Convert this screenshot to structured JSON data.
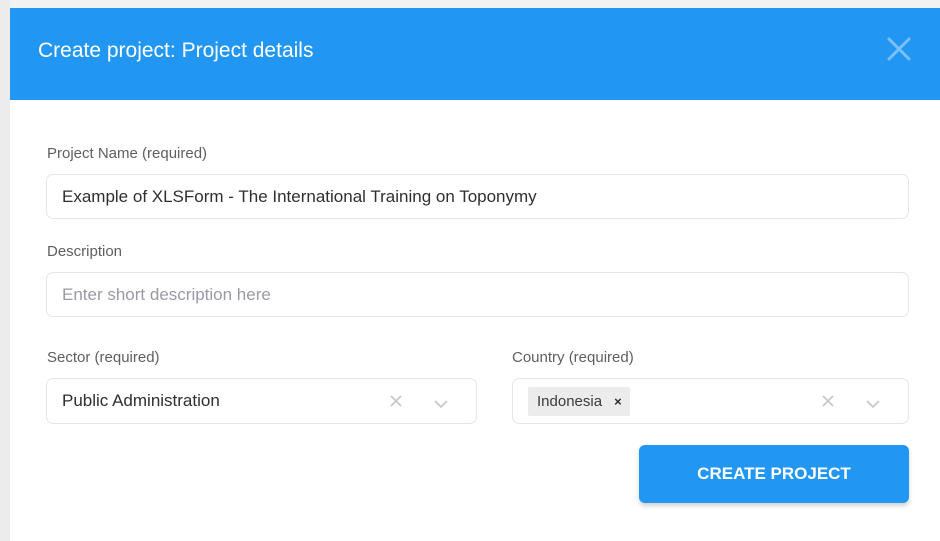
{
  "modal": {
    "title": "Create project: Project details",
    "close_icon": "close-icon"
  },
  "form": {
    "project_name": {
      "label": "Project Name (required)",
      "value": "Example of XLSForm - The International Training on Toponymy"
    },
    "description": {
      "label": "Description",
      "value": "",
      "placeholder": "Enter short description here"
    },
    "sector": {
      "label": "Sector (required)",
      "value": "Public Administration",
      "clear_icon": "clear-icon",
      "dropdown_icon": "chevron-down-icon"
    },
    "country": {
      "label": "Country (required)",
      "selected": [
        "Indonesia"
      ],
      "chip_remove": "×",
      "clear_icon": "clear-icon",
      "dropdown_icon": "chevron-down-icon"
    },
    "submit_label": "CREATE PROJECT"
  },
  "colors": {
    "header_bg": "#2196f3",
    "button_bg": "#2196f3",
    "field_border": "#e6e6e6"
  }
}
